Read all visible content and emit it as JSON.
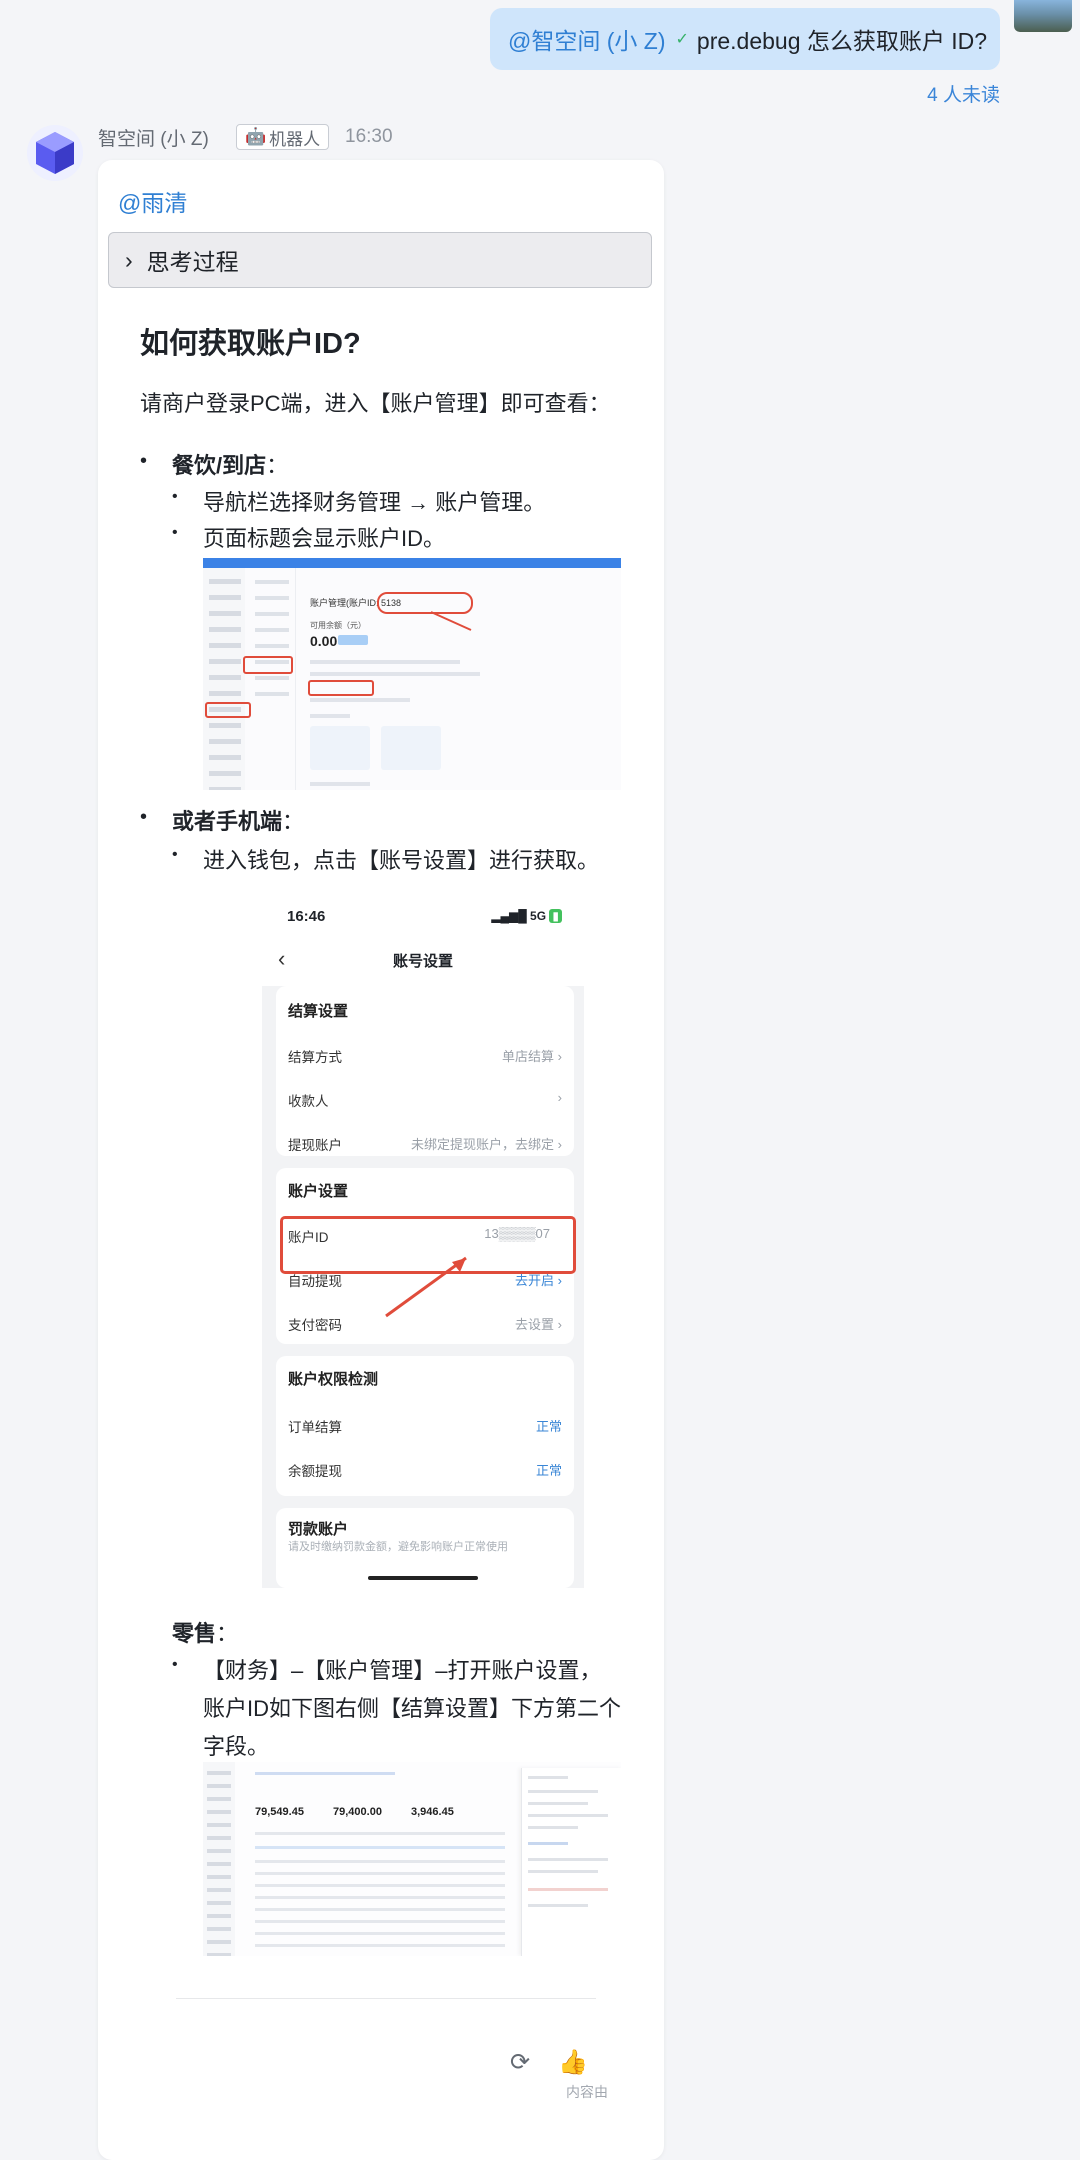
{
  "user_message": {
    "mention": "@智空间 (小 Z)",
    "text": "pre.debug 怎么获取账户 ID?",
    "read_status": "4 人未读"
  },
  "bot": {
    "name": "智空间 (小 Z)",
    "tag": "机器人",
    "time": "16:30",
    "reply_mention": "@雨清",
    "thinking_label": "思考过程",
    "heading": "如何获取账户ID?",
    "intro": "请商户登录PC端，进入【账户管理】即可查看：",
    "sections": [
      {
        "title": "餐饮/到店",
        "colon": "：",
        "steps": [
          "导航栏选择财务管理 → 账户管理。",
          "页面标题会显示账户ID。"
        ]
      },
      {
        "title": "或者手机端",
        "colon": "：",
        "steps": [
          "进入钱包，点击【账号设置】进行获取。"
        ]
      },
      {
        "title": "零售",
        "colon": "：",
        "steps": [
          "【财务】–【账户管理】–打开账户设置，",
          "账户ID如下图右侧【结算设置】下方第二个",
          "字段。"
        ]
      }
    ],
    "footer_note": "内容由"
  },
  "screenshot_pc": {
    "page_title": "账户管理(账户ID: 5138",
    "balance_label": "可用余额（元）",
    "balance": "0.00"
  },
  "screenshot_phone": {
    "time": "16:46",
    "network": "5G",
    "title": "账号设置",
    "settlement": {
      "header": "结算设置",
      "rows": [
        {
          "label": "结算方式",
          "value": "单店结算 ›"
        },
        {
          "label": "收款人",
          "value": "›"
        },
        {
          "label": "提现账户",
          "value": "未绑定提现账户，去绑定 ›"
        }
      ]
    },
    "account": {
      "header": "账户设置",
      "rows": [
        {
          "label": "账户ID",
          "value": "13▒▒▒▒07"
        },
        {
          "label": "自动提现",
          "value": "去开启 ›"
        },
        {
          "label": "支付密码",
          "value": "去设置 ›"
        }
      ]
    },
    "permissions": {
      "header": "账户权限检测",
      "rows": [
        {
          "label": "订单结算",
          "value": "正常"
        },
        {
          "label": "余额提现",
          "value": "正常"
        }
      ]
    },
    "penalty": {
      "header": "罚款账户",
      "note": "请及时缴纳罚款金额，避免影响账户正常使用"
    }
  },
  "screenshot_retail": {
    "amounts": [
      "79,549.45",
      "79,400.00",
      "3,946.45"
    ]
  },
  "colors": {
    "accent": "#2f7fd3",
    "user_bubble": "#cfe5fb",
    "highlight": "#e04c3b"
  }
}
